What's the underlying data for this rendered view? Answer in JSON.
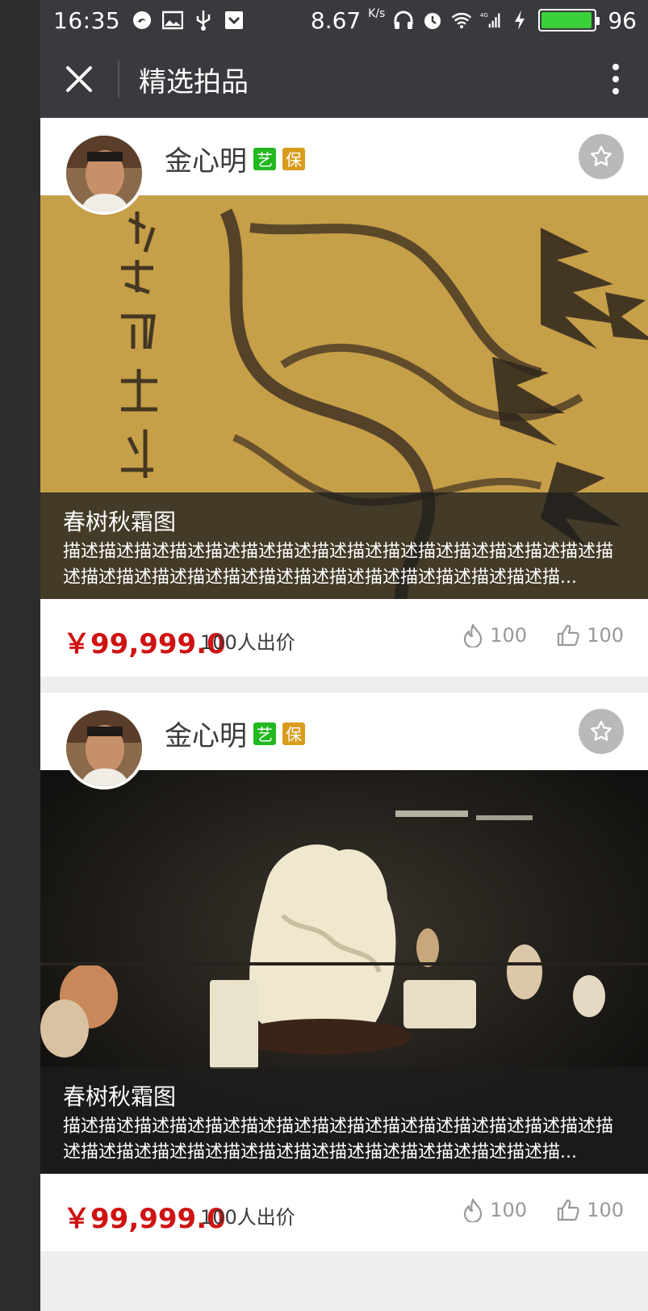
{
  "status_bar": {
    "time": "16:35",
    "net_speed": "8.67",
    "net_unit": "K/s",
    "net_type": "4G",
    "battery_level": "96",
    "battery_fraction": 0.96,
    "icons": [
      "swirl-icon",
      "image-icon",
      "usb-icon",
      "download-icon",
      "headphones-icon",
      "alarm-icon",
      "wifi-icon",
      "signal-icon",
      "charging-icon",
      "battery-icon"
    ]
  },
  "nav": {
    "title": "精选拍品"
  },
  "colors": {
    "header_bg": "#393a3e",
    "price": "#cf1212",
    "muted": "#999999",
    "text": "#393a3e",
    "art_badge": "#22b820",
    "guarantee_badge": "#d99b1e"
  },
  "cards": [
    {
      "seller_name": "金心明",
      "badge_art": "艺",
      "badge_guarantee": "保",
      "title": "春树秋霜图",
      "description": "描述描述描述描述描述描述描述描述描述描述描述描述描述描述描述描述描述描述描述描述描述描述描述描述描述描述描述描述描述描...",
      "price": "￥99,999.0",
      "bidders": "100人出价",
      "hot_count": "100",
      "like_count": "100"
    },
    {
      "seller_name": "金心明",
      "badge_art": "艺",
      "badge_guarantee": "保",
      "title": "春树秋霜图",
      "description": "描述描述描述描述描述描述描述描述描述描述描述描述描述描述描述描述描述描述描述描述描述描述描述描述描述描述描述描述描述描...",
      "price": "￥99,999.0",
      "bidders": "100人出价",
      "hot_count": "100",
      "like_count": "100"
    }
  ]
}
